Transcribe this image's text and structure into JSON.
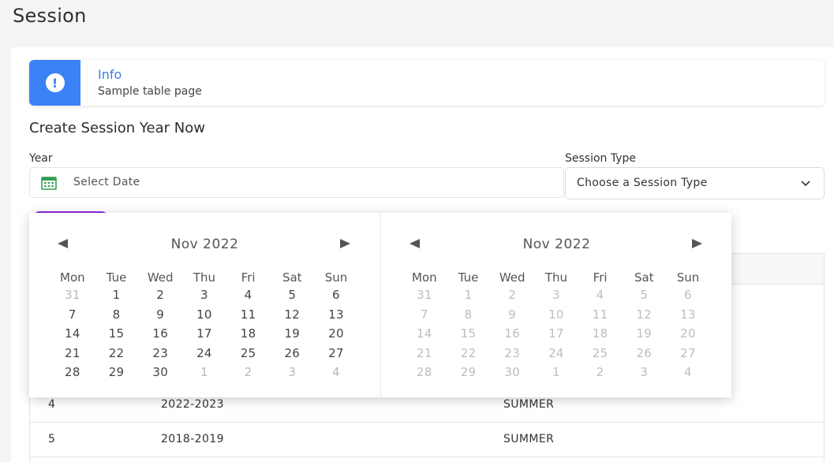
{
  "page": {
    "title": "Session"
  },
  "alert": {
    "title": "Info",
    "message": "Sample table page",
    "icon": "exclamation-circle-icon",
    "accent": "#3b82f6"
  },
  "form": {
    "heading": "Create Session Year Now",
    "year_label": "Year",
    "year_placeholder": "Select Date",
    "session_type_label": "Session Type",
    "session_type_value": "Choose a Session Type"
  },
  "table": {
    "rows": [
      {
        "id": "4",
        "year": "2022-2023",
        "type": "SUMMER"
      },
      {
        "id": "5",
        "year": "2018-2019",
        "type": "SUMMER"
      }
    ]
  },
  "datepicker": {
    "weekdays": [
      "Mon",
      "Tue",
      "Wed",
      "Thu",
      "Fri",
      "Sat",
      "Sun"
    ],
    "months": [
      {
        "title": "Nov 2022",
        "days": [
          {
            "d": "31",
            "off": true
          },
          {
            "d": "1",
            "off": false
          },
          {
            "d": "2",
            "off": false
          },
          {
            "d": "3",
            "off": false
          },
          {
            "d": "4",
            "off": false
          },
          {
            "d": "5",
            "off": false
          },
          {
            "d": "6",
            "off": false
          },
          {
            "d": "7",
            "off": false
          },
          {
            "d": "8",
            "off": false
          },
          {
            "d": "9",
            "off": false
          },
          {
            "d": "10",
            "off": false
          },
          {
            "d": "11",
            "off": false
          },
          {
            "d": "12",
            "off": false
          },
          {
            "d": "13",
            "off": false
          },
          {
            "d": "14",
            "off": false
          },
          {
            "d": "15",
            "off": false
          },
          {
            "d": "16",
            "off": false
          },
          {
            "d": "17",
            "off": false
          },
          {
            "d": "18",
            "off": false
          },
          {
            "d": "19",
            "off": false
          },
          {
            "d": "20",
            "off": false
          },
          {
            "d": "21",
            "off": false
          },
          {
            "d": "22",
            "off": false
          },
          {
            "d": "23",
            "off": false
          },
          {
            "d": "24",
            "off": false
          },
          {
            "d": "25",
            "off": false
          },
          {
            "d": "26",
            "off": false
          },
          {
            "d": "27",
            "off": false
          },
          {
            "d": "28",
            "off": false
          },
          {
            "d": "29",
            "off": false
          },
          {
            "d": "30",
            "off": false
          },
          {
            "d": "1",
            "off": true
          },
          {
            "d": "2",
            "off": true
          },
          {
            "d": "3",
            "off": true
          },
          {
            "d": "4",
            "off": true
          }
        ]
      },
      {
        "title": "Nov 2022",
        "days": [
          {
            "d": "31",
            "off": true
          },
          {
            "d": "1",
            "off": true
          },
          {
            "d": "2",
            "off": true
          },
          {
            "d": "3",
            "off": true
          },
          {
            "d": "4",
            "off": true
          },
          {
            "d": "5",
            "off": true
          },
          {
            "d": "6",
            "off": true
          },
          {
            "d": "7",
            "off": true
          },
          {
            "d": "8",
            "off": true
          },
          {
            "d": "9",
            "off": true
          },
          {
            "d": "10",
            "off": true
          },
          {
            "d": "11",
            "off": true
          },
          {
            "d": "12",
            "off": true
          },
          {
            "d": "13",
            "off": true
          },
          {
            "d": "14",
            "off": true
          },
          {
            "d": "15",
            "off": true
          },
          {
            "d": "16",
            "off": true
          },
          {
            "d": "17",
            "off": true
          },
          {
            "d": "18",
            "off": true
          },
          {
            "d": "19",
            "off": true
          },
          {
            "d": "20",
            "off": true
          },
          {
            "d": "21",
            "off": true
          },
          {
            "d": "22",
            "off": true
          },
          {
            "d": "23",
            "off": true
          },
          {
            "d": "24",
            "off": true
          },
          {
            "d": "25",
            "off": true
          },
          {
            "d": "26",
            "off": true
          },
          {
            "d": "27",
            "off": true
          },
          {
            "d": "28",
            "off": true
          },
          {
            "d": "29",
            "off": true
          },
          {
            "d": "30",
            "off": true
          },
          {
            "d": "1",
            "off": true
          },
          {
            "d": "2",
            "off": true
          },
          {
            "d": "3",
            "off": true
          },
          {
            "d": "4",
            "off": true
          }
        ]
      }
    ]
  }
}
